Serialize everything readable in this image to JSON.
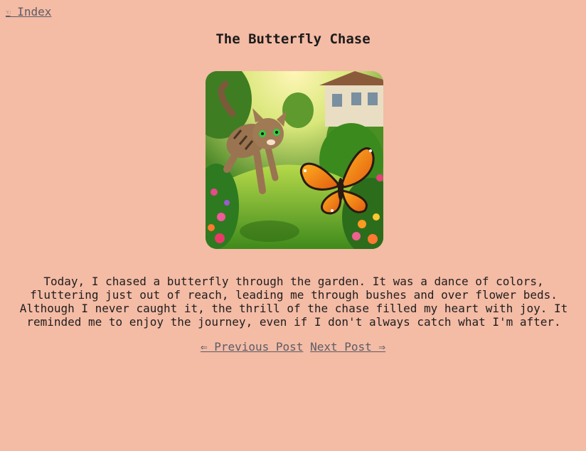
{
  "nav": {
    "index_icon": "pointing-hand-icon",
    "index_glyph": "☜",
    "index_label": "Index"
  },
  "post": {
    "title": "The Butterfly Chase",
    "image_alt": "A tabby cat leaping through a sunny flower garden chasing an orange monarch butterfly",
    "body": "Today, I chased a butterfly through the garden. It was a dance of colors, fluttering just out of reach, leading me through bushes and over flower beds. Although I never caught it, the thrill of the chase filled my heart with joy. It reminded me to enjoy the journey, even if I don't always catch what I'm after."
  },
  "pagination": {
    "previous_label": "⇐ Previous Post",
    "next_label": "Next Post ⇒"
  },
  "colors": {
    "background": "#f4bba5",
    "link": "#5c5c66",
    "text": "#1e1e1e"
  }
}
